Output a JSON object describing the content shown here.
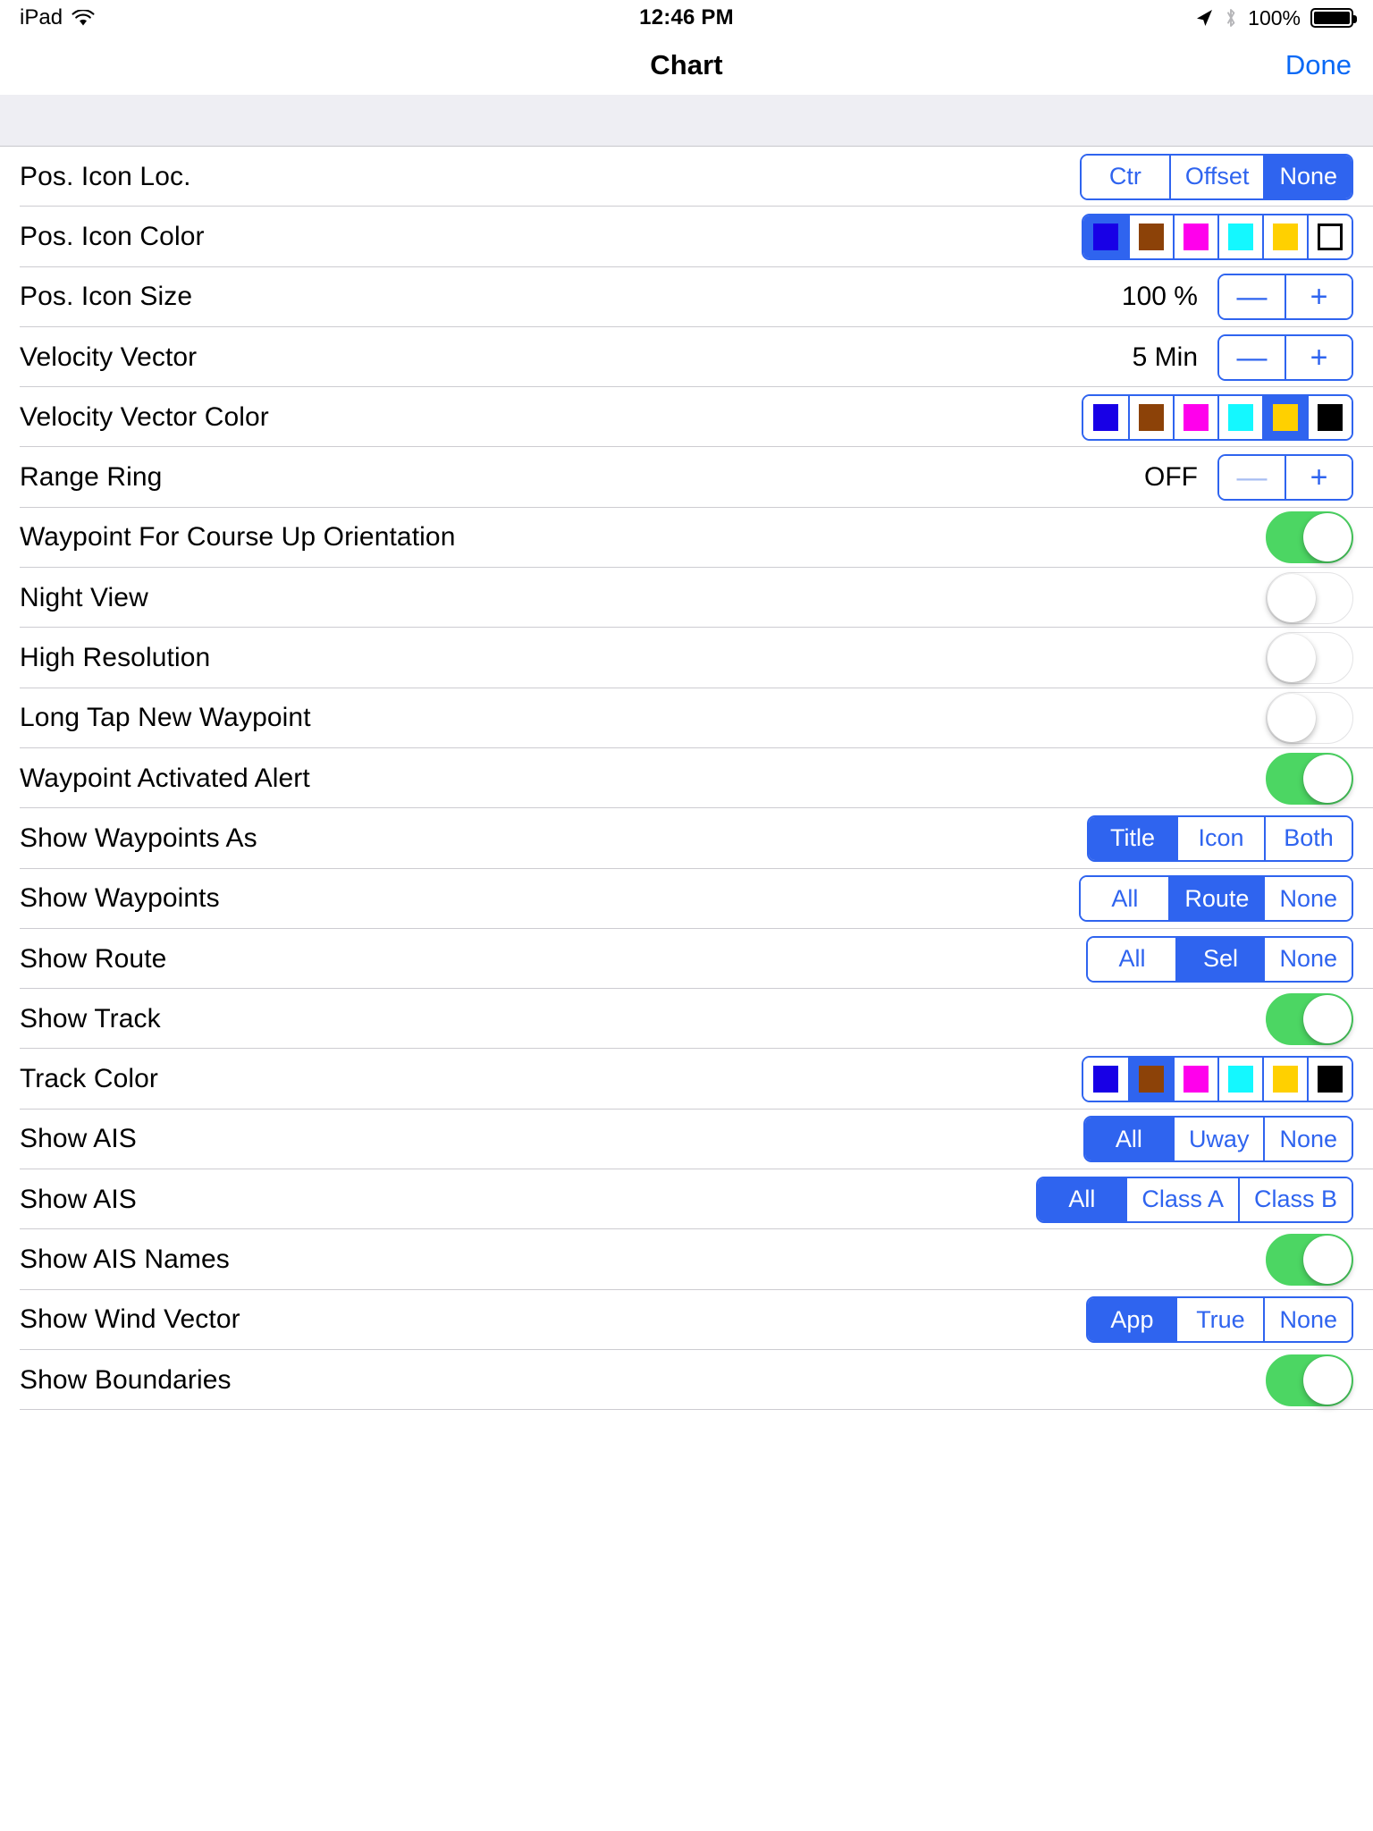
{
  "status_bar": {
    "device": "iPad",
    "wifi_icon": "wifi-icon",
    "time": "12:46 PM",
    "location_icon": "location-arrow-icon",
    "bluetooth_icon": "bluetooth-icon",
    "battery_percent": "100%",
    "battery_icon": "battery-full-icon"
  },
  "nav": {
    "title": "Chart",
    "done_label": "Done"
  },
  "colors": {
    "accent_blue": "#2f64ef",
    "link_blue": "#0a69f5",
    "switch_green": "#4cd663",
    "separator": "#c8c7cc",
    "header_gray": "#eeeef3",
    "swatch_blue": "#1800e6",
    "swatch_brown": "#8c4208",
    "swatch_magenta": "#ff00ec",
    "swatch_cyan": "#14f8ff",
    "swatch_yellow": "#ffd000",
    "swatch_black": "#000000",
    "swatch_white": "#ffffff"
  },
  "rows": [
    {
      "label": "Pos. Icon Loc.",
      "type": "segmented",
      "options": [
        "Ctr",
        "Offset",
        "None"
      ],
      "selected": 2
    },
    {
      "label": "Pos. Icon Color",
      "type": "swatches",
      "options": [
        "blue",
        "brown",
        "magenta",
        "cyan",
        "yellow",
        "white"
      ],
      "selected": 0
    },
    {
      "label": "Pos. Icon Size",
      "type": "stepper",
      "value": "100 %",
      "minus_label": "—",
      "plus_label": "+",
      "minus_disabled": false
    },
    {
      "label": "Velocity Vector",
      "type": "stepper",
      "value": "5 Min",
      "minus_label": "—",
      "plus_label": "+",
      "minus_disabled": false
    },
    {
      "label": "Velocity Vector Color",
      "type": "swatches",
      "options": [
        "blue",
        "brown",
        "magenta",
        "cyan",
        "yellow",
        "black"
      ],
      "selected": 4
    },
    {
      "label": "Range Ring",
      "type": "stepper",
      "value": "OFF",
      "minus_label": "—",
      "plus_label": "+",
      "minus_disabled": true
    },
    {
      "label": "Waypoint For Course Up Orientation",
      "type": "switch",
      "on": true
    },
    {
      "label": "Night View",
      "type": "switch",
      "on": false
    },
    {
      "label": "High Resolution",
      "type": "switch",
      "on": false
    },
    {
      "label": "Long Tap New Waypoint",
      "type": "switch",
      "on": false
    },
    {
      "label": "Waypoint Activated Alert",
      "type": "switch",
      "on": true
    },
    {
      "label": "Show Waypoints As",
      "type": "segmented",
      "options": [
        "Title",
        "Icon",
        "Both"
      ],
      "selected": 0
    },
    {
      "label": "Show Waypoints",
      "type": "segmented",
      "options": [
        "All",
        "Route",
        "None"
      ],
      "selected": 1
    },
    {
      "label": "Show Route",
      "type": "segmented",
      "options": [
        "All",
        "Sel",
        "None"
      ],
      "selected": 1
    },
    {
      "label": "Show Track",
      "type": "switch",
      "on": true
    },
    {
      "label": "Track Color",
      "type": "swatches",
      "options": [
        "blue",
        "brown",
        "magenta",
        "cyan",
        "yellow",
        "black"
      ],
      "selected": 1
    },
    {
      "label": "Show AIS",
      "type": "segmented",
      "options": [
        "All",
        "Uway",
        "None"
      ],
      "selected": 0
    },
    {
      "label": "Show AIS",
      "type": "segmented",
      "options": [
        "All",
        "Class A",
        "Class B"
      ],
      "selected": 0
    },
    {
      "label": "Show AIS Names",
      "type": "switch",
      "on": true
    },
    {
      "label": "Show Wind Vector",
      "type": "segmented",
      "options": [
        "App",
        "True",
        "None"
      ],
      "selected": 0
    },
    {
      "label": "Show Boundaries",
      "type": "switch",
      "on": true
    }
  ]
}
